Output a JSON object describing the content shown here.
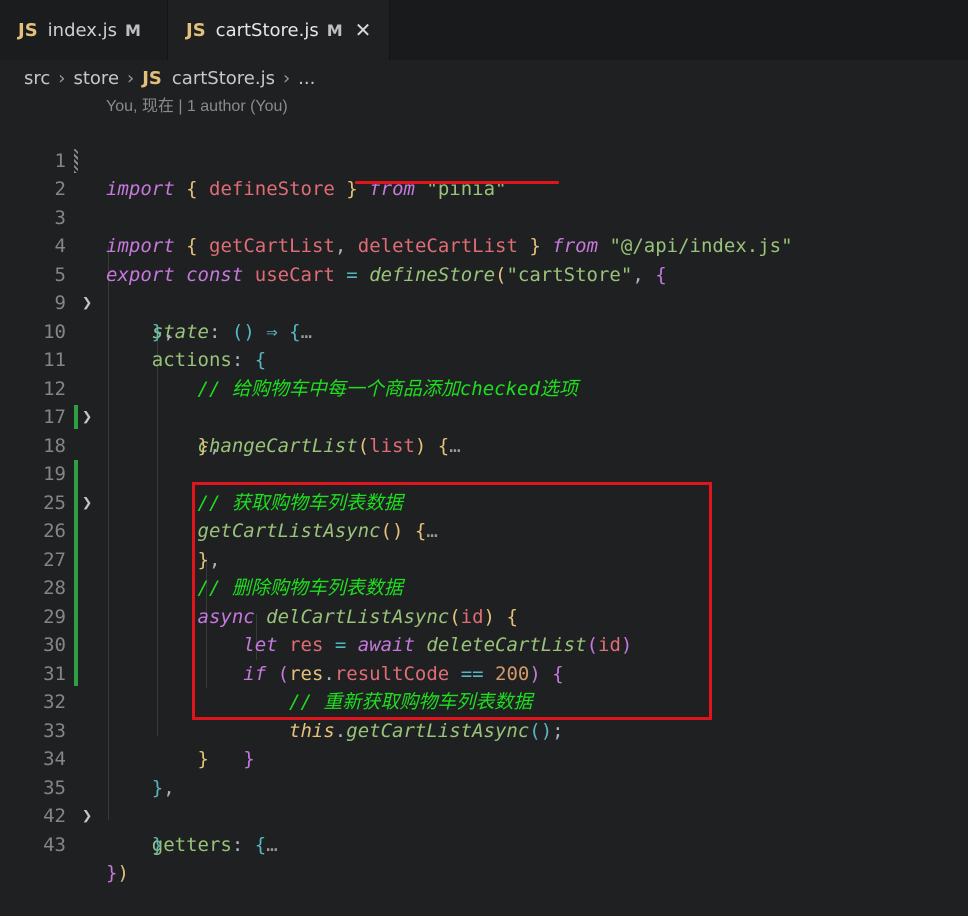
{
  "tabs": [
    {
      "icon": "JS",
      "name": "index.js",
      "status": "M"
    },
    {
      "icon": "JS",
      "name": "cartStore.js",
      "status": "M",
      "close": "✕"
    }
  ],
  "breadcrumb": {
    "src": "src",
    "store": "store",
    "icon": "JS",
    "file": "cartStore.js",
    "more": "..."
  },
  "blame": "You, 现在 | 1 author (You)",
  "lines": [
    {
      "n": "1"
    },
    {
      "n": "2"
    },
    {
      "n": "3"
    },
    {
      "n": "4"
    },
    {
      "n": "5"
    },
    {
      "n": "9"
    },
    {
      "n": "10"
    },
    {
      "n": "11"
    },
    {
      "n": "12"
    },
    {
      "n": "17"
    },
    {
      "n": "18"
    },
    {
      "n": "19"
    },
    {
      "n": "25"
    },
    {
      "n": "26"
    },
    {
      "n": "27"
    },
    {
      "n": "28"
    },
    {
      "n": "29"
    },
    {
      "n": "30"
    },
    {
      "n": "31"
    },
    {
      "n": "32"
    },
    {
      "n": "33"
    },
    {
      "n": "34"
    },
    {
      "n": "35"
    },
    {
      "n": "42"
    },
    {
      "n": "43"
    }
  ],
  "code": {
    "kw_import": "import",
    "kw_from": "from",
    "kw_export": "export",
    "kw_const": "const",
    "kw_async": "async",
    "kw_let": "let",
    "kw_await": "await",
    "kw_if": "if",
    "kw_this": "this",
    "defineStore": "defineStore",
    "pinia": "\"pinia\"",
    "getCartList": "getCartList",
    "deleteCartList": "deleteCartList",
    "api_path": "\"@/api/index.js\"",
    "useCart": "useCart",
    "cartStore": "\"cartStore\"",
    "state": "state",
    "actions": "actions",
    "getters": "getters",
    "cmt_add_checked": "// 给购物车中每一个商品添加checked选项",
    "changeCartList": "changeCartList",
    "list": "list",
    "cmt_get_list": "// 获取购物车列表数据",
    "getCartListAsync": "getCartListAsync",
    "cmt_delete": "// 删除购物车列表数据",
    "delCartListAsync": "delCartListAsync",
    "id": "id",
    "res": "res",
    "resultCode": "resultCode",
    "num200": "200",
    "cmt_refresh": "// 重新获取购物车列表数据",
    "ellipsis": "…"
  },
  "colors": {
    "highlight_red": "#e0141b",
    "gutter_modified": "#2ea043",
    "gutter_changed": "#8a8a8a"
  }
}
